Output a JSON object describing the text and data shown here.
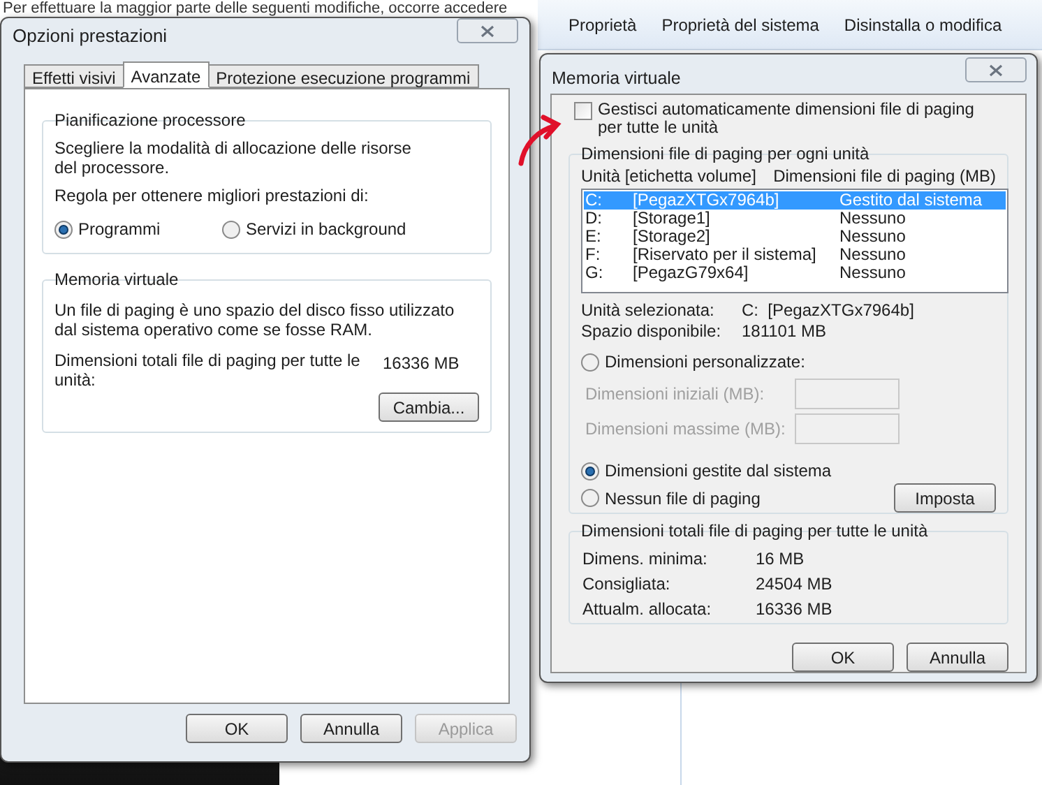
{
  "background": {
    "banner_text": "Per effettuare la maggior parte delle seguenti modifiche, occorre accedere",
    "toolbar": [
      {
        "label": "Proprietà"
      },
      {
        "label": "Proprietà del sistema"
      },
      {
        "label": "Disinstalla o modifica"
      }
    ]
  },
  "performance_dialog": {
    "title": "Opzioni prestazioni",
    "tabs": [
      {
        "label": "Effetti visivi",
        "selected": false
      },
      {
        "label": "Avanzate",
        "selected": true
      },
      {
        "label": "Protezione esecuzione programmi",
        "selected": false
      }
    ],
    "processor_group": {
      "title": "Pianificazione processore",
      "description": "Scegliere la modalità di allocazione delle risorse del processore.",
      "prompt": "Regola per ottenere migliori prestazioni di:",
      "options": [
        {
          "label": "Programmi",
          "selected": true
        },
        {
          "label": "Servizi in background",
          "selected": false
        }
      ]
    },
    "virtual_memory_group": {
      "title": "Memoria virtuale",
      "description": "Un file di paging è uno spazio del disco fisso utilizzato dal sistema operativo come se fosse RAM.",
      "total_label": "Dimensioni totali file di paging per tutte le unità:",
      "total_value": "16336 MB",
      "button": "Cambia..."
    },
    "buttons": [
      {
        "label": "OK",
        "disabled": false
      },
      {
        "label": "Annulla",
        "disabled": false
      },
      {
        "label": "Applica",
        "disabled": true
      }
    ]
  },
  "virtual_memory_dialog": {
    "title": "Memoria virtuale",
    "auto_manage": {
      "label": "Gestisci automaticamente dimensioni file di paging per tutte le unità",
      "checked": false
    },
    "drives_group": {
      "title": "Dimensioni file di paging per ogni unità",
      "columns": [
        "Unità [etichetta volume]",
        "Dimensioni file di paging (MB)"
      ],
      "drives": [
        {
          "letter": "C:",
          "label": "[PegazXTGx7964b]",
          "size": "Gestito dal sistema",
          "selected": true
        },
        {
          "letter": "D:",
          "label": "[Storage1]",
          "size": "Nessuno",
          "selected": false
        },
        {
          "letter": "E:",
          "label": "[Storage2]",
          "size": "Nessuno",
          "selected": false
        },
        {
          "letter": "F:",
          "label": "[Riservato per il sistema]",
          "size": "Nessuno",
          "selected": false
        },
        {
          "letter": "G:",
          "label": "[PegazG79x64]",
          "size": "Nessuno",
          "selected": false
        }
      ],
      "info": [
        {
          "label": "Unità selezionata:",
          "value": "C:  [PegazXTGx7964b]"
        },
        {
          "label": "Spazio disponibile:",
          "value": "181101 MB"
        }
      ],
      "custom_size": {
        "label": "Dimensioni personalizzate:",
        "selected": false
      },
      "fields": [
        {
          "label": "Dimensioni iniziali (MB):",
          "disabled": true
        },
        {
          "label": "Dimensioni massime (MB):",
          "disabled": true
        }
      ],
      "system_managed": {
        "label": "Dimensioni gestite dal sistema",
        "selected": true
      },
      "no_paging": {
        "label": "Nessun file di paging",
        "selected": false
      },
      "set_button": "Imposta"
    },
    "totals_group": {
      "title": "Dimensioni totali file di paging per tutte le unità",
      "rows": [
        {
          "label": "Dimens. minima:",
          "value": "16 MB"
        },
        {
          "label": "Consigliata:",
          "value": "24504 MB"
        },
        {
          "label": "Attualm. allocata:",
          "value": "16336 MB"
        }
      ]
    },
    "buttons": [
      {
        "label": "OK",
        "disabled": false
      },
      {
        "label": "Annulla",
        "disabled": false
      }
    ]
  }
}
